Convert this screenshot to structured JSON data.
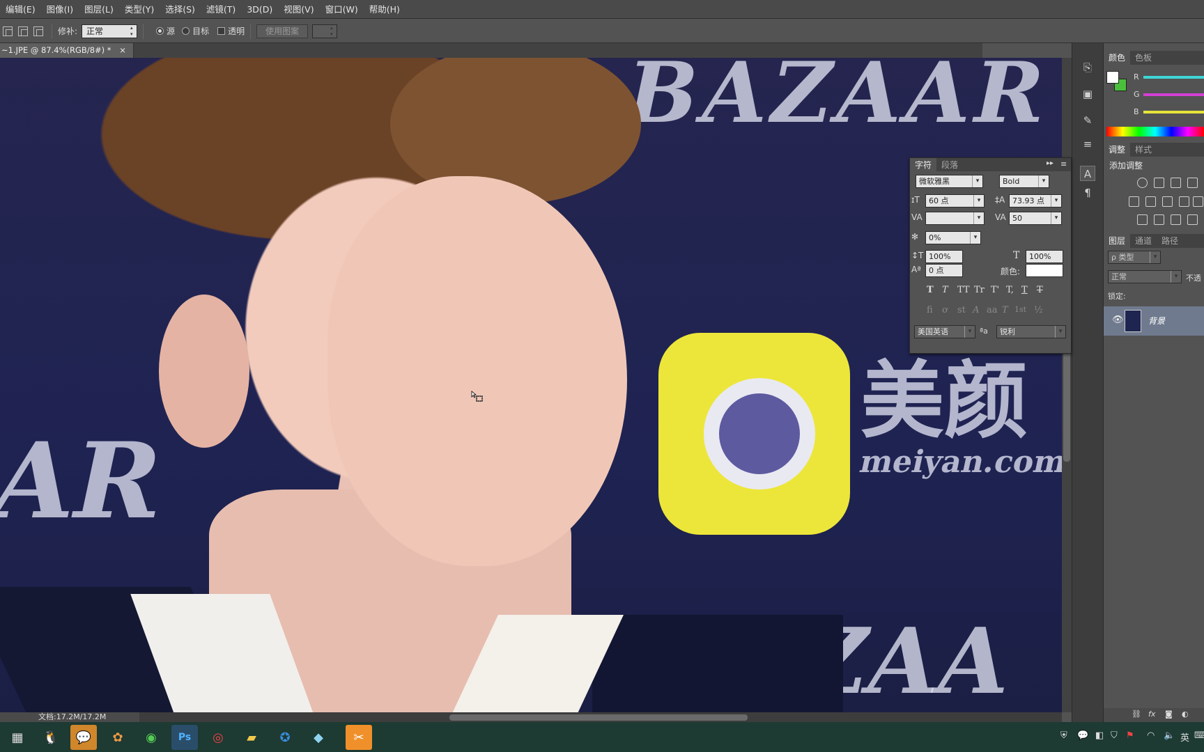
{
  "menu": [
    "编辑(E)",
    "图像(I)",
    "图层(L)",
    "类型(Y)",
    "选择(S)",
    "滤镜(T)",
    "3D(D)",
    "视图(V)",
    "窗口(W)",
    "帮助(H)"
  ],
  "options": {
    "patch_label": "修补:",
    "patch_mode": "正常",
    "source_label": "源",
    "target_label": "目标",
    "transparent_label": "透明",
    "use_pattern_label": "使用图案"
  },
  "document": {
    "tab_title": "~1.JPE @ 87.4%(RGB/8#) *",
    "close": "×",
    "status": "文档:17.2M/17.2M"
  },
  "canvas_text": {
    "bazaar_top": "BAZAAR",
    "bazaar_left": "AR",
    "bazaar_bottom": "AZAA",
    "brand_cn": "美颜",
    "brand_url": "meiyan.com"
  },
  "color_panel": {
    "tabs": [
      "颜色",
      "色板"
    ],
    "channels": [
      "R",
      "G",
      "B"
    ],
    "channel_colors": [
      "#3fd6d8",
      "#d43fd6",
      "#e6e43a"
    ]
  },
  "adjust_panel": {
    "tabs": [
      "调整",
      "样式"
    ],
    "title": "添加调整"
  },
  "layers_panel": {
    "tabs": [
      "图层",
      "通道",
      "路径"
    ],
    "filter": "ρ 类型",
    "blend": "正常",
    "opacity_label": "不透",
    "lock_label": "锁定:",
    "layer_name": "背景"
  },
  "char_panel": {
    "tabs": [
      "字符",
      "段落"
    ],
    "font_family": "微软雅黑",
    "font_style": "Bold",
    "font_size": "60 点",
    "leading": "73.93 点",
    "kerning": "",
    "tracking": "50",
    "tsume": "0%",
    "vscale": "100%",
    "hscale": "100%",
    "baseline": "0 点",
    "color_label": "颜色:",
    "color": "#ffffff",
    "language": "美国英语",
    "aa_label": "ªa",
    "antialias": "锐利",
    "format_row1": [
      "T",
      "T",
      "TT",
      "Tr",
      "T'",
      "T,",
      "T",
      "T"
    ],
    "format_row2": [
      "fi",
      "ơ",
      "st",
      "A",
      "aa",
      "T",
      "1st",
      "½"
    ]
  },
  "tray": {
    "ime": "英"
  }
}
